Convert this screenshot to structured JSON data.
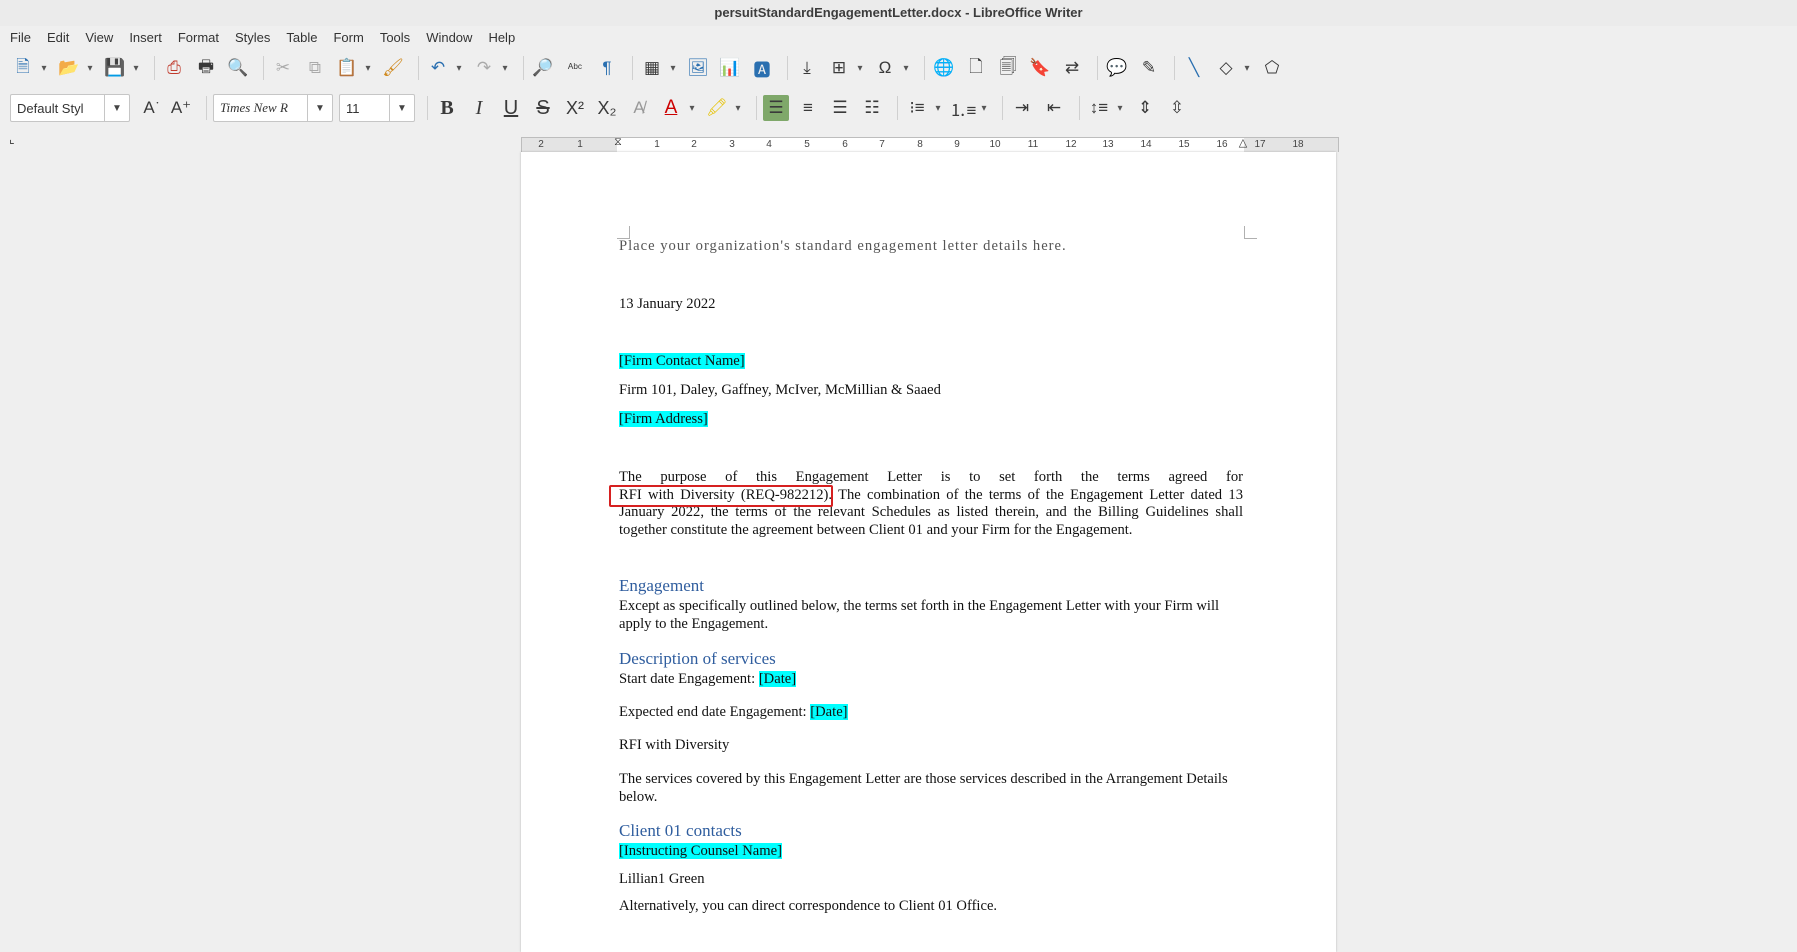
{
  "window": {
    "title": "persuitStandardEngagementLetter.docx - LibreOffice Writer"
  },
  "menu": [
    "File",
    "Edit",
    "View",
    "Insert",
    "Format",
    "Styles",
    "Table",
    "Form",
    "Tools",
    "Window",
    "Help"
  ],
  "formatting": {
    "paragraph_style": "Default Styl",
    "font_name": "Times New R",
    "font_size": "11"
  },
  "ruler": {
    "ticks": [
      "2",
      "1",
      "1",
      "2",
      "3",
      "4",
      "5",
      "6",
      "7",
      "8",
      "9",
      "10",
      "11",
      "12",
      "13",
      "14",
      "15",
      "16",
      "17",
      "18"
    ]
  },
  "icons": {
    "toolbar1": [
      "new-document-icon",
      "open-icon",
      "save-icon",
      "export-pdf-icon",
      "print-icon",
      "print-preview-icon",
      "cut-icon",
      "copy-icon",
      "paste-icon",
      "clone-formatting-icon",
      "undo-icon",
      "redo-icon",
      "find-replace-icon",
      "spelling-icon",
      "formatting-marks-icon",
      "insert-table-icon",
      "insert-image-icon",
      "insert-chart-icon",
      "insert-textbox-icon",
      "page-break-icon",
      "insert-field-icon",
      "special-character-icon",
      "hyperlink-icon",
      "footnote-icon",
      "endnote-icon",
      "bookmark-icon",
      "cross-reference-icon",
      "comment-icon",
      "track-changes-icon",
      "line-icon",
      "basic-shapes-icon",
      "draw-functions-icon"
    ],
    "toolbar2": [
      "update-style-icon",
      "new-style-icon",
      "bold-icon",
      "italic-icon",
      "underline-icon",
      "strikethrough-icon",
      "superscript-icon",
      "subscript-icon",
      "clear-formatting-icon",
      "font-color-icon",
      "highlight-icon",
      "align-left-icon",
      "align-center-icon",
      "align-right-icon",
      "justify-icon",
      "bullets-icon",
      "numbering-icon",
      "increase-indent-icon",
      "decrease-indent-icon",
      "line-spacing-icon",
      "paragraph-spacing-increase-icon",
      "paragraph-spacing-decrease-icon"
    ]
  },
  "document": {
    "placeholder_line": "Place your organization's standard engagement letter details here.",
    "date": "13 January 2022",
    "firm_contact_name": "[Firm Contact Name]",
    "firm_line": "Firm 101, Daley, Gaffney, McIver, McMillian & Saaed",
    "firm_address": "[Firm Address]",
    "purpose_line1": "The purpose of this Engagement Letter is to set forth the terms agreed for",
    "purpose_selected": "RFI with Diversity (REQ-982212).",
    "purpose_rest": " The combination of the terms of the Engagement Letter dated 13 January 2022, the terms of the relevant Schedules as listed therein, and the Billing Guidelines shall together constitute the agreement between Client 01 and your Firm for the Engagement.",
    "heading_engagement": "Engagement",
    "engagement_text": "Except as specifically outlined below, the terms set forth in the Engagement Letter with your Firm will apply to the Engagement.",
    "heading_services": "Description of services",
    "start_date_label": "Start date Engagement: ",
    "start_date_value": "[Date]",
    "end_date_label": "Expected end date Engagement: ",
    "end_date_value": "[Date]",
    "service_name": "RFI with Diversity",
    "services_text": "The services covered by this Engagement Letter are those services described in the Arrangement Details below.",
    "heading_contacts": "Client 01 contacts",
    "instructing_counsel": "[Instructing Counsel Name]",
    "contact_name": "Lillian1 Green",
    "alt_correspondence": "Alternatively, you can direct correspondence to Client 01 Office."
  }
}
